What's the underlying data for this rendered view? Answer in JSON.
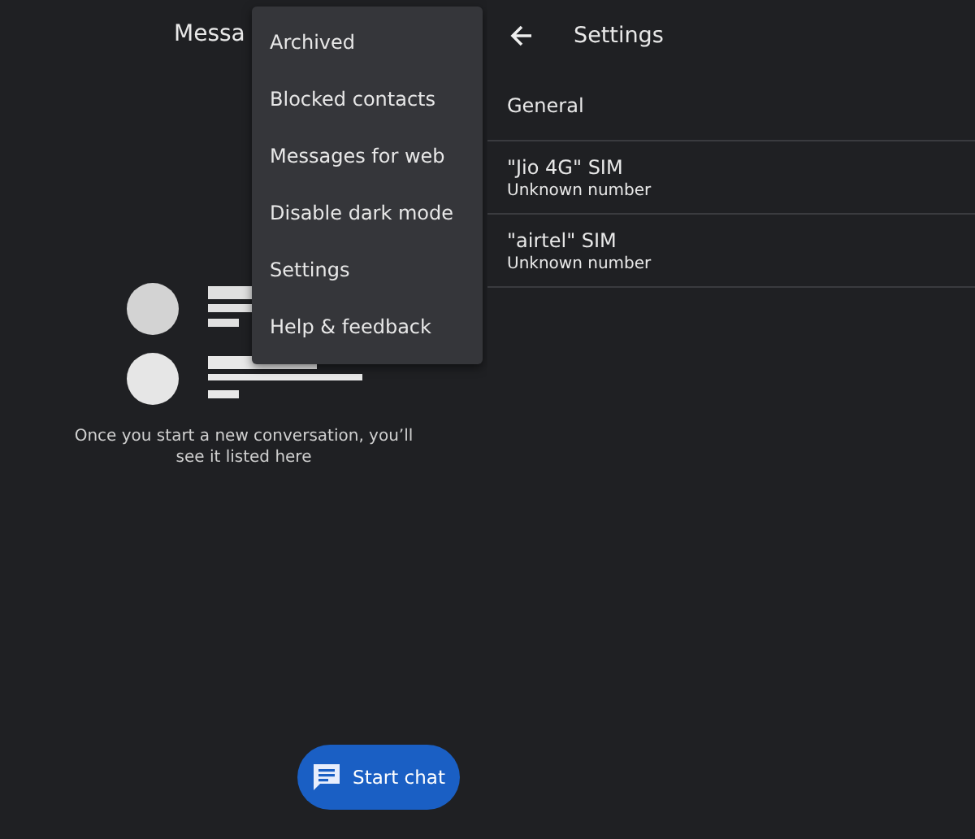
{
  "left_screen": {
    "title": "Messa",
    "empty_message": "Once you start a new conversation, you’ll see it listed here",
    "fab": {
      "label": "Start chat"
    }
  },
  "overflow_menu": {
    "items": [
      {
        "label": "Archived"
      },
      {
        "label": "Blocked contacts"
      },
      {
        "label": "Messages for web"
      },
      {
        "label": "Disable dark mode"
      },
      {
        "label": "Settings"
      },
      {
        "label": "Help & feedback"
      }
    ]
  },
  "right_screen": {
    "title": "Settings",
    "items": [
      {
        "title": "General"
      },
      {
        "title": "\"Jio 4G\" SIM",
        "subtitle": "Unknown number"
      },
      {
        "title": "\"airtel\" SIM",
        "subtitle": "Unknown number"
      }
    ]
  }
}
